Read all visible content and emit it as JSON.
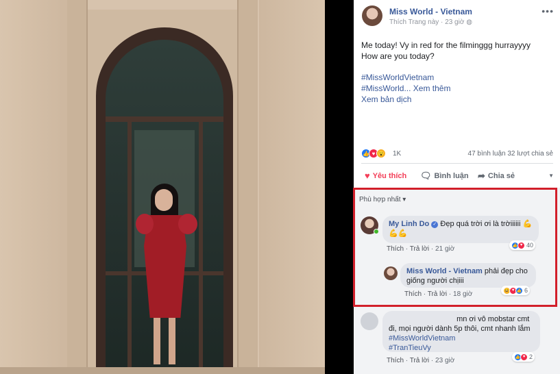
{
  "post": {
    "page_name": "Miss World - Vietnam",
    "like_page": "Thích Trang này",
    "time": "23 giờ",
    "more": "•••",
    "line1": "Me today! Vy in red for the filminggg hurrayyyy",
    "line2": "How are you today?",
    "hashtag1": "#MissWorldVietnam",
    "hashtag2": "#MissWorld... Xem thêm",
    "translate": "Xem bản dịch"
  },
  "stats": {
    "reactions_count": "1K",
    "comments": "47 bình luận",
    "shares": "32 lượt chia sẻ"
  },
  "actions": {
    "love": "Yêu thích",
    "comment": "Bình luận",
    "share": "Chia sẻ"
  },
  "comments": {
    "filter": "Phù hợp nhất",
    "c1": {
      "author": "My Linh Do",
      "text": "Đẹp quá trời ơi là trờiiiiii 💪 💪💪",
      "like": "Thích",
      "reply": "Trả lời",
      "time": "21 giờ",
      "reactions": "40"
    },
    "c2": {
      "author": "Miss World - Vietnam",
      "text": "phải đẹp cho giống người chịiii",
      "like": "Thích",
      "reply": "Trả lời",
      "time": "18 giờ",
      "reactions": "6"
    },
    "c3": {
      "text1": "mn ơi vô mobstar cmt",
      "text2": "đi, mọi người dành 5p thôi, cmt nhanh lắm",
      "tag1": "#MissWorldVietnam",
      "tag2": "#TranTieuVy",
      "like": "Thích",
      "reply": "Trả lời",
      "time": "23 giờ",
      "reactions": "2"
    }
  },
  "colors": {
    "link": "#385898",
    "love": "#f33e58",
    "highlight": "#d21f2a",
    "dress": "#a11d26"
  }
}
